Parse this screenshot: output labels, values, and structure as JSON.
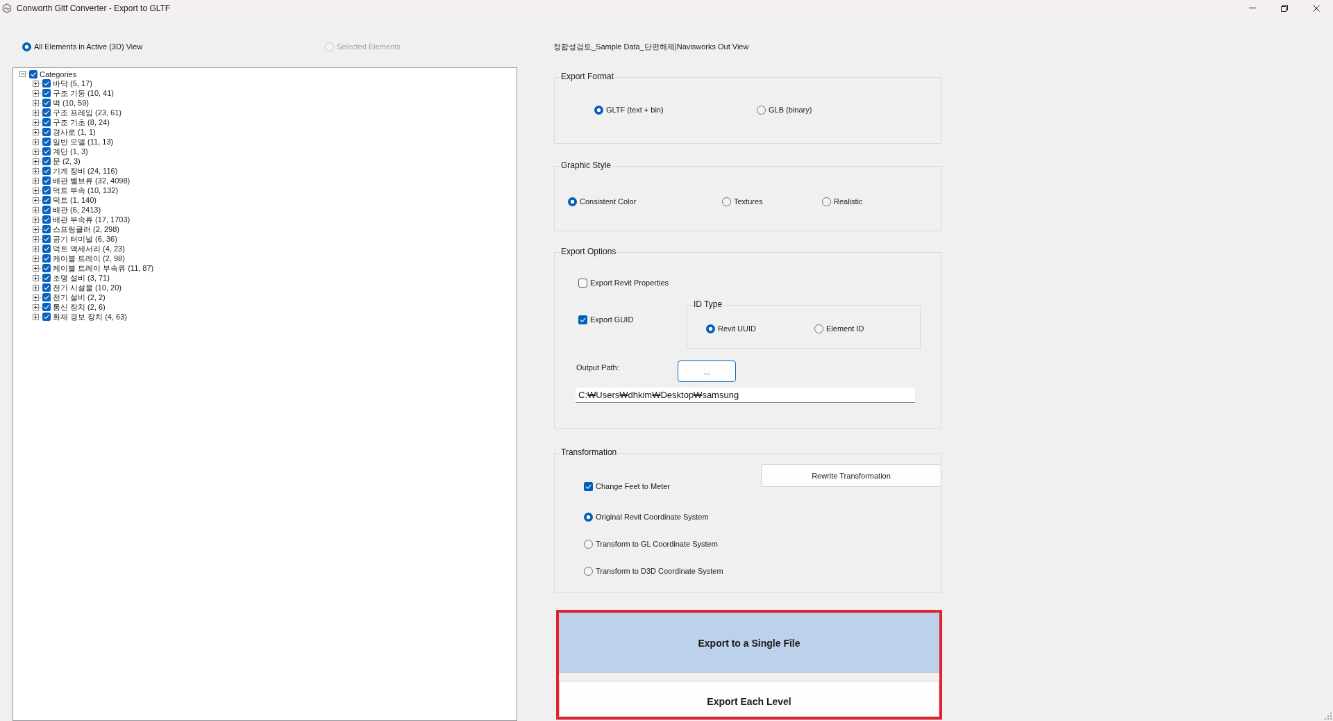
{
  "window": {
    "title": "Conworth Gltf Converter - Export to GLTF"
  },
  "scope_options": [
    {
      "label": "All Elements in Active (3D) View",
      "selected": true,
      "disabled": false
    },
    {
      "label": "Selected Elements",
      "selected": false,
      "disabled": true
    }
  ],
  "view_name": "정합성검토_Sample Data_단면해제|Navisworks Out View",
  "category_tree": {
    "label": "Categories",
    "checked": true,
    "expanded": true,
    "children": [
      {
        "label": "바닥 (5, 17)",
        "checked": true,
        "expanded": false
      },
      {
        "label": "구조 기둥 (10, 41)",
        "checked": true,
        "expanded": false
      },
      {
        "label": "벽 (10, 59)",
        "checked": true,
        "expanded": false
      },
      {
        "label": "구조 프레임 (23, 61)",
        "checked": true,
        "expanded": false
      },
      {
        "label": "구조 기초 (8, 24)",
        "checked": true,
        "expanded": false
      },
      {
        "label": "경사로 (1, 1)",
        "checked": true,
        "expanded": false
      },
      {
        "label": "일반 모델 (11, 13)",
        "checked": true,
        "expanded": false
      },
      {
        "label": "계단 (1, 3)",
        "checked": true,
        "expanded": false
      },
      {
        "label": "문 (2, 3)",
        "checked": true,
        "expanded": false
      },
      {
        "label": "기계 장비 (24, 116)",
        "checked": true,
        "expanded": false
      },
      {
        "label": "배관 밸브류 (32, 4098)",
        "checked": true,
        "expanded": false
      },
      {
        "label": "덕트 부속 (10, 132)",
        "checked": true,
        "expanded": false
      },
      {
        "label": "덕트 (1, 140)",
        "checked": true,
        "expanded": false
      },
      {
        "label": "배관 (6, 2413)",
        "checked": true,
        "expanded": false
      },
      {
        "label": "배관 부속류 (17, 1703)",
        "checked": true,
        "expanded": false
      },
      {
        "label": "스프링클러 (2, 298)",
        "checked": true,
        "expanded": false
      },
      {
        "label": "공기 터미널 (6, 36)",
        "checked": true,
        "expanded": false
      },
      {
        "label": "덕트 액세서리 (4, 23)",
        "checked": true,
        "expanded": false
      },
      {
        "label": "케이블 트레이 (2, 98)",
        "checked": true,
        "expanded": false
      },
      {
        "label": "케이블 트레이 부속류 (11, 87)",
        "checked": true,
        "expanded": false
      },
      {
        "label": "조명 설비 (3, 71)",
        "checked": true,
        "expanded": false
      },
      {
        "label": "전기 시설물 (10, 20)",
        "checked": true,
        "expanded": false
      },
      {
        "label": "전기 설비 (2, 2)",
        "checked": true,
        "expanded": false
      },
      {
        "label": "통신 장치 (2, 6)",
        "checked": true,
        "expanded": false
      },
      {
        "label": "화재 경보 장치 (4, 63)",
        "checked": true,
        "expanded": false
      }
    ]
  },
  "export_format": {
    "title": "Export Format",
    "options": [
      {
        "label": "GLTF (text + bin)",
        "selected": true
      },
      {
        "label": "GLB (binary)",
        "selected": false
      }
    ]
  },
  "graphic_style": {
    "title": "Graphic Style",
    "options": [
      {
        "label": "Consistent Color",
        "selected": true
      },
      {
        "label": "Textures",
        "selected": false
      },
      {
        "label": "Realistic",
        "selected": false
      }
    ]
  },
  "export_options": {
    "title": "Export Options",
    "checkboxes": [
      {
        "label": "Export Revit Properties",
        "checked": false
      },
      {
        "label": "Export GUID",
        "checked": true
      }
    ],
    "id_type": {
      "title": "ID Type",
      "options": [
        {
          "label": "Revit UUID",
          "selected": true
        },
        {
          "label": "Element ID",
          "selected": false
        }
      ]
    },
    "output_path": {
      "label": "Output Path:",
      "browse_button": {
        "label": "...",
        "focused": true
      },
      "value": "C:₩Users₩dhkim₩Desktop₩samsung"
    }
  },
  "transformation": {
    "title": "Transformation",
    "rewrite_button": "Rewrite Transformation",
    "feet_to_meter": {
      "label": "Change Feet to Meter",
      "checked": true
    },
    "coordinate_systems": [
      {
        "label": "Original Revit Coordinate System",
        "selected": true
      },
      {
        "label": "Transform to GL Coordinate System",
        "selected": false
      },
      {
        "label": "Transform to D3D Coordinate System",
        "selected": false
      }
    ]
  },
  "export_buttons": [
    {
      "label": "Export to a Single File",
      "highlighted": true
    },
    {
      "label": "Export Each Level",
      "highlighted": false
    }
  ]
}
